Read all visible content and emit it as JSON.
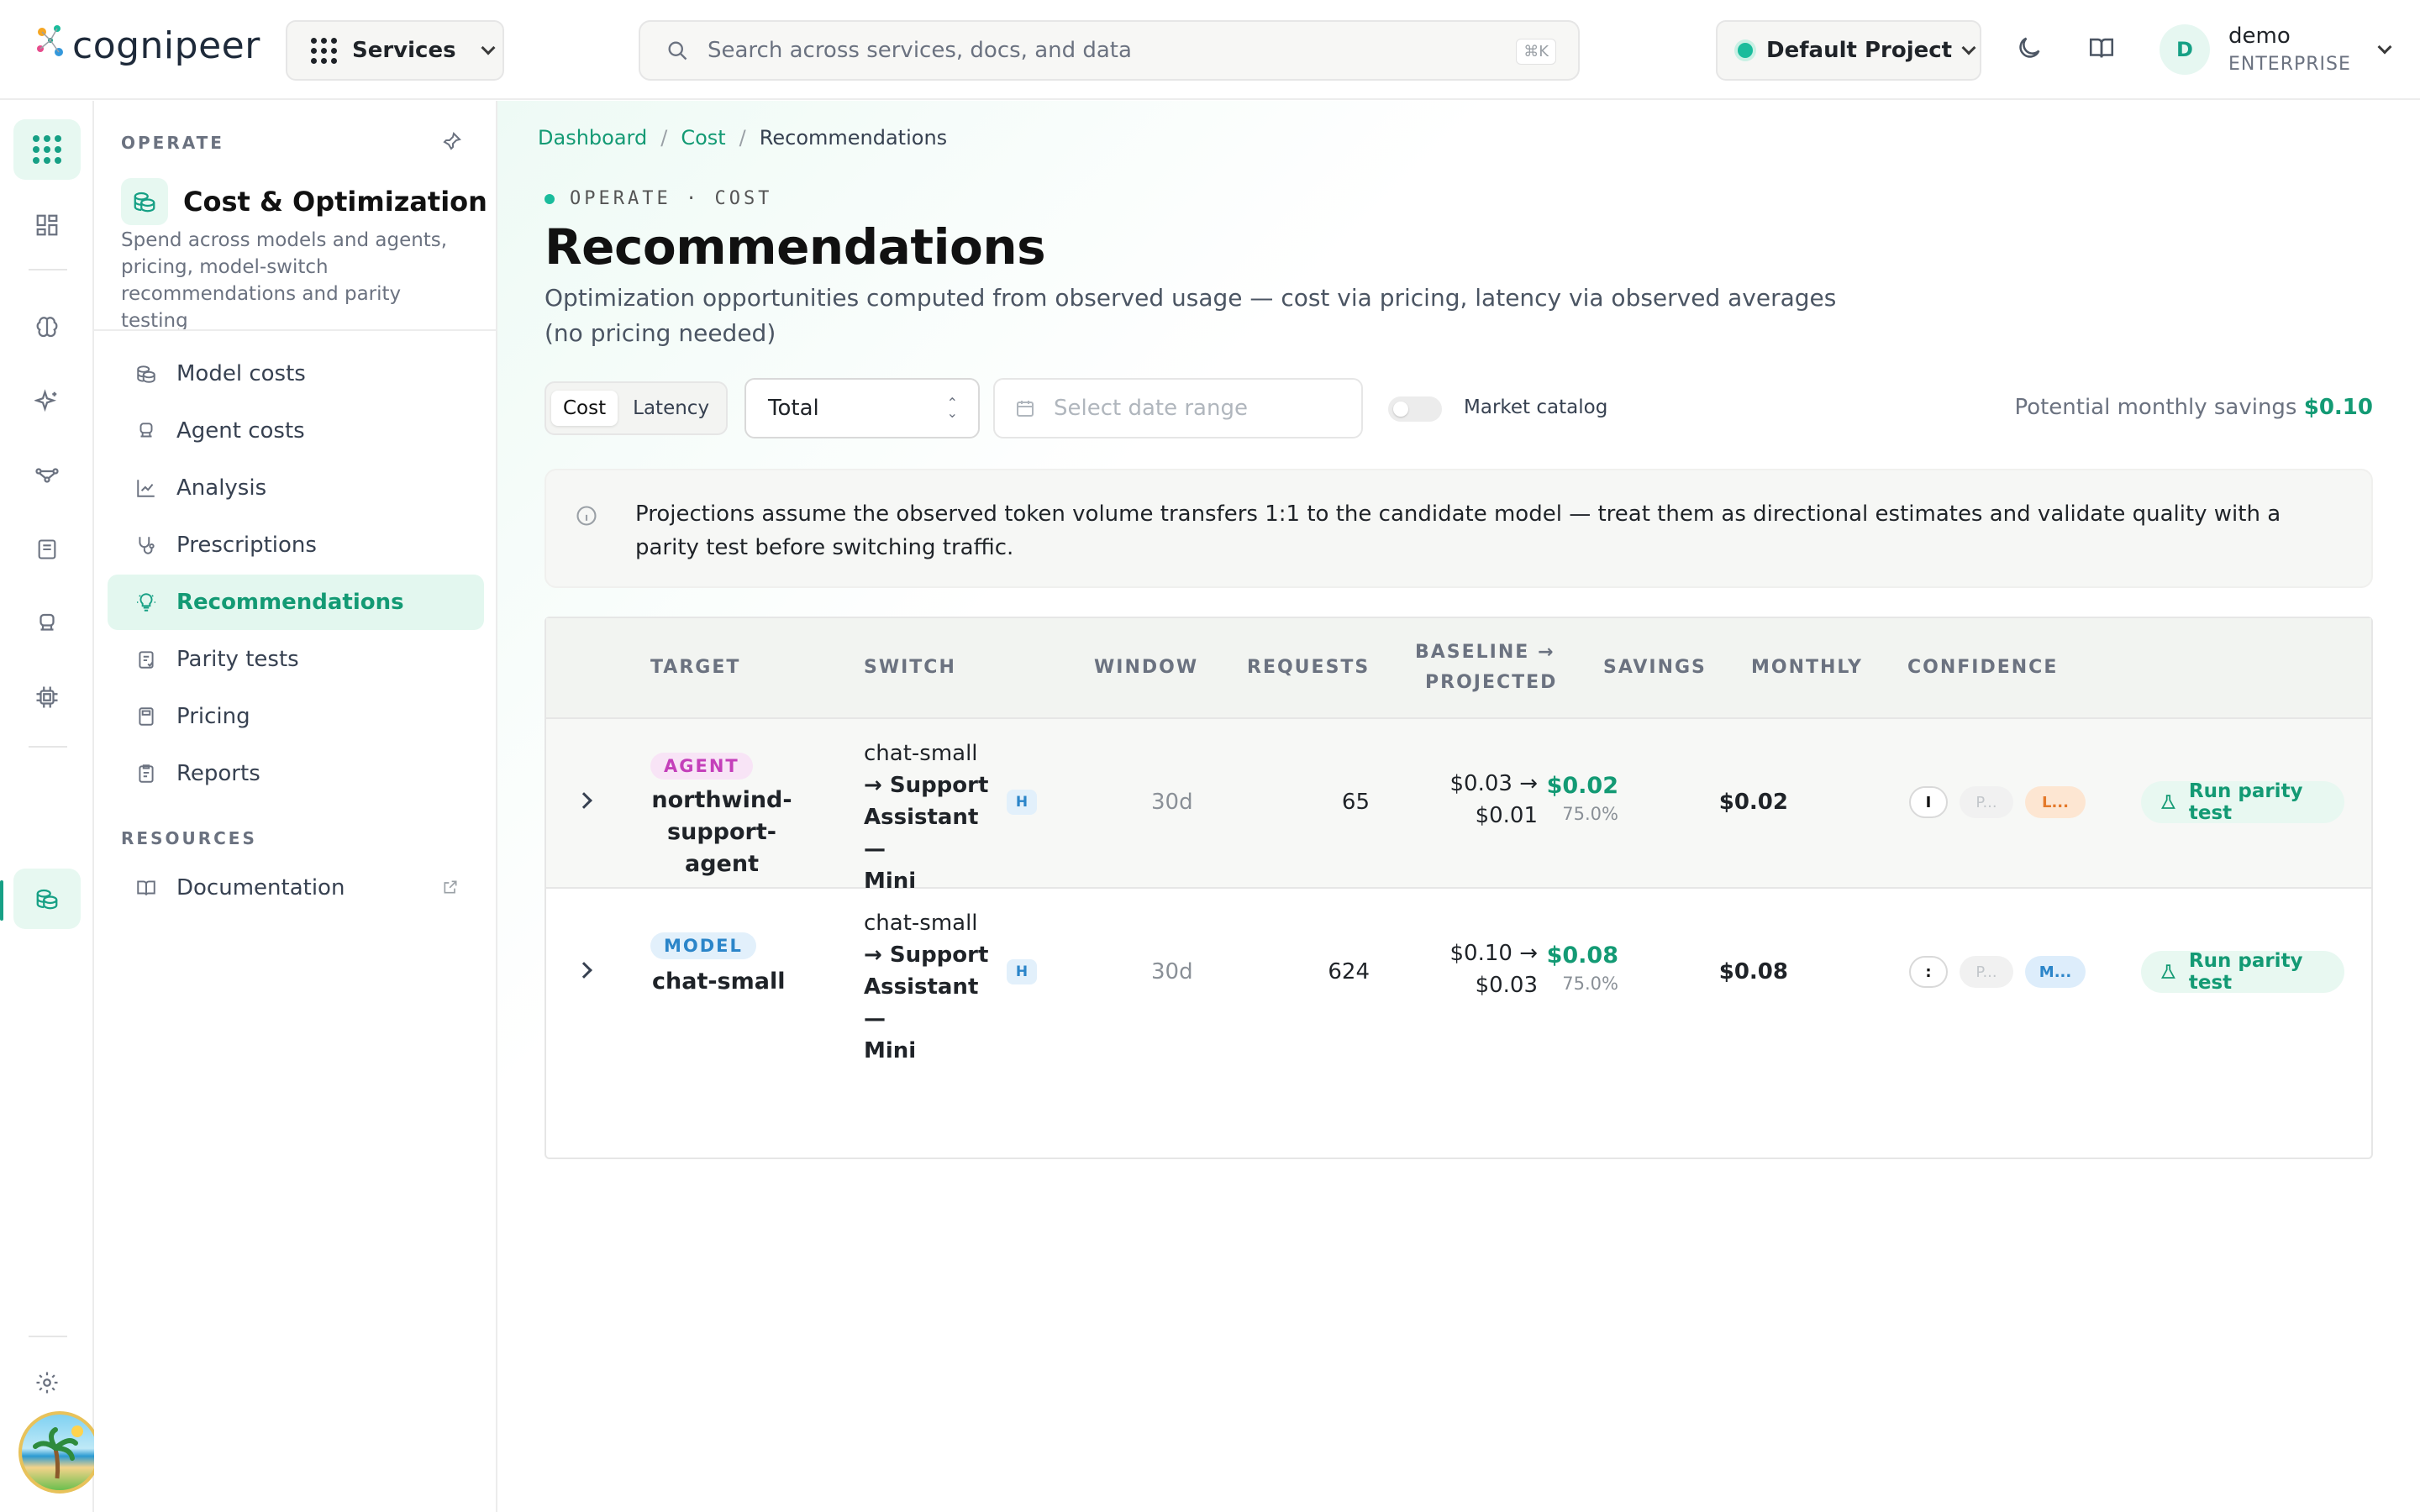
{
  "app": {
    "logo_text": "cognipeer",
    "services_label": "Services",
    "search_placeholder": "Search across services, docs, and data",
    "search_shortcut": "⌘K",
    "project_label": "Default Project",
    "user_name": "demo",
    "user_plan": "ENTERPRISE",
    "user_initial": "D"
  },
  "rail": {
    "icons": [
      "apps-grid-icon",
      "dashboard-icon",
      "brain-icon",
      "sparkles-icon",
      "flow-icon",
      "document-icon",
      "agent-icon",
      "chip-icon",
      "cost-icon"
    ],
    "active": "cost-icon",
    "settings_icon": "gear-icon"
  },
  "sidebar": {
    "section": "OPERATE",
    "title": "Cost & Optimization",
    "description": "Spend across models and agents, pricing, model-switch recommendations and parity testing",
    "items": [
      {
        "label": "Model costs",
        "icon": "coins-icon"
      },
      {
        "label": "Agent costs",
        "icon": "robot-icon"
      },
      {
        "label": "Analysis",
        "icon": "chart-icon"
      },
      {
        "label": "Prescriptions",
        "icon": "stethoscope-icon"
      },
      {
        "label": "Recommendations",
        "icon": "lightbulb-icon",
        "active": true
      },
      {
        "label": "Parity tests",
        "icon": "clipboard-icon"
      },
      {
        "label": "Pricing",
        "icon": "calculator-icon"
      },
      {
        "label": "Reports",
        "icon": "report-icon"
      }
    ],
    "resources_section": "RESOURCES",
    "resources": [
      {
        "label": "Documentation",
        "icon": "book-icon",
        "external": true
      }
    ]
  },
  "main": {
    "breadcrumb": [
      "Dashboard",
      "Cost",
      "Recommendations"
    ],
    "eyebrow": "OPERATE · COST",
    "title": "Recommendations",
    "subtitle": "Optimization opportunities computed from observed usage — cost via pricing, latency via observed averages (no pricing needed)",
    "segment": {
      "options": [
        "Cost",
        "Latency"
      ],
      "selected": "Cost"
    },
    "aggregation_select": "Total",
    "date_range_placeholder": "Select date range",
    "market_catalog_label": "Market catalog",
    "market_catalog_on": false,
    "savings_label": "Potential monthly savings",
    "savings_value": "$0.10",
    "notice": "Projections assume the observed token volume transfers 1:1 to the candidate model — treat them as directional estimates and validate quality with a parity test before switching traffic."
  },
  "table": {
    "columns": [
      "TARGET",
      "SWITCH",
      "WINDOW",
      "REQUESTS",
      "BASELINE →",
      "PROJECTED",
      "SAVINGS",
      "MONTHLY",
      "CONFIDENCE"
    ],
    "rows": [
      {
        "type": "AGENT",
        "target_line1": "northwind-",
        "target_line2": "support-agent",
        "switch_from": "chat-small",
        "switch_to_line1": "→ Support",
        "switch_to_line2": "Assistant —",
        "switch_to_line3": "Mini",
        "switch_badge": "H",
        "window": "30d",
        "requests": "65",
        "baseline": "$0.03 →",
        "projected": "$0.01",
        "savings": "$0.02",
        "savings_pct": "75.0%",
        "monthly": "$0.02",
        "conf1": "I",
        "conf2": "P...",
        "conf3": "L...",
        "action": "Run parity test"
      },
      {
        "type": "MODEL",
        "target_line1": "chat-small",
        "target_line2": "",
        "switch_from": "chat-small",
        "switch_to_line1": "→ Support",
        "switch_to_line2": "Assistant —",
        "switch_to_line3": "Mini",
        "switch_badge": "H",
        "window": "30d",
        "requests": "624",
        "baseline": "$0.10 →",
        "projected": "$0.03",
        "savings": "$0.08",
        "savings_pct": "75.0%",
        "monthly": "$0.08",
        "conf1": ":",
        "conf2": "P...",
        "conf3": "M...",
        "action": "Run parity test"
      }
    ]
  },
  "colors": {
    "accent": "#139a74",
    "accent_bg": "#e3f7ef",
    "agent_badge": "#c43fba",
    "model_badge": "#2b85c9"
  }
}
